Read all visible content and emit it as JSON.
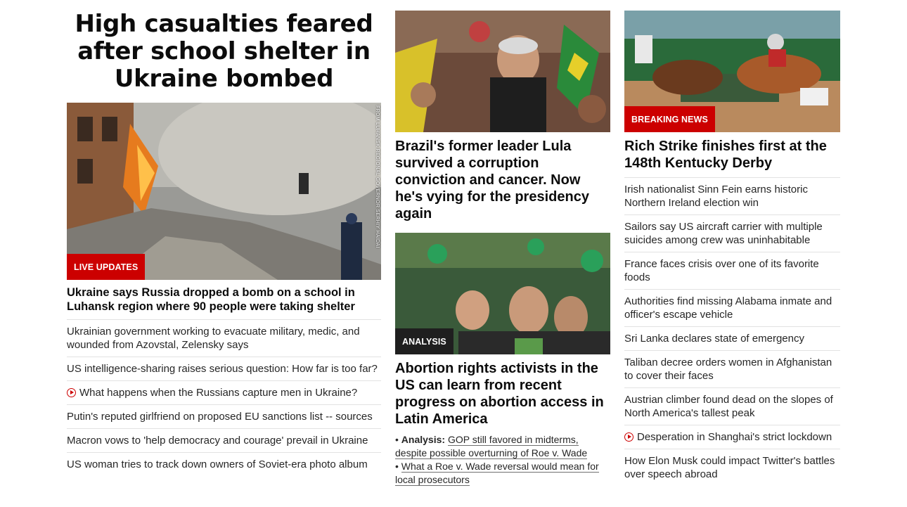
{
  "col1": {
    "banner": "High casualties feared after school shelter in Ukraine bombed",
    "hero_badge": "LIVE UPDATES",
    "hero_credit": "FROM LUHANSK REGIONAL GOVERNOR SERHIY HAIDAI",
    "lead_headline": "Ukraine says Russia dropped a bomb on a school in Luhansk region where 90 people were taking shelter",
    "links": [
      {
        "text": "Ukrainian government working to evacuate military, medic, and wounded from Azovstal, Zelensky says",
        "video": false
      },
      {
        "text": "US intelligence-sharing raises serious question: How far is too far?",
        "video": false
      },
      {
        "text": "What happens when the Russians capture men in Ukraine?",
        "video": true
      },
      {
        "text": "Putin's reputed girlfriend on proposed EU sanctions list -- sources",
        "video": false
      },
      {
        "text": "Macron vows to 'help democracy and courage' prevail in Ukraine",
        "video": false
      },
      {
        "text": "US woman tries to track down owners of Soviet-era photo album",
        "video": false
      }
    ]
  },
  "col2": {
    "story1_headline": "Brazil's former leader Lula survived a corruption conviction and cancer. Now he's vying for the presidency again",
    "story2_badge": "ANALYSIS",
    "story2_headline": "Abortion rights activists in the US can learn from recent progress on abortion access in Latin America",
    "sub_links": [
      {
        "prefix": "Analysis:",
        "line1": "GOP still favored in midterms,",
        "line2": "despite possible overturning of Roe v. Wade"
      },
      {
        "prefix": "",
        "line1": "What a Roe v. Wade reversal would mean for",
        "line2": "local prosecutors"
      }
    ]
  },
  "col3": {
    "badge": "BREAKING NEWS",
    "headline": "Rich Strike finishes first at the 148th Kentucky Derby",
    "links": [
      {
        "text": "Irish nationalist Sinn Fein earns historic Northern Ireland election win",
        "video": false
      },
      {
        "text": "Sailors say US aircraft carrier with multiple suicides among crew was uninhabitable",
        "video": false
      },
      {
        "text": "France faces crisis over one of its favorite foods",
        "video": false
      },
      {
        "text": "Authorities find missing Alabama inmate and officer's escape vehicle",
        "video": false
      },
      {
        "text": "Sri Lanka declares state of emergency",
        "video": false
      },
      {
        "text": "Taliban decree orders women in Afghanistan to cover their faces",
        "video": false
      },
      {
        "text": "Austrian climber found dead on the slopes of North America's tallest peak",
        "video": false
      },
      {
        "text": "Desperation in Shanghai's strict lockdown",
        "video": true
      },
      {
        "text": "How Elon Musk could impact Twitter's battles over speech abroad",
        "video": false
      }
    ]
  },
  "colors": {
    "red": "#cc0000",
    "dark_badge": "#1f1f1f",
    "divider": "#e2e2e2"
  }
}
